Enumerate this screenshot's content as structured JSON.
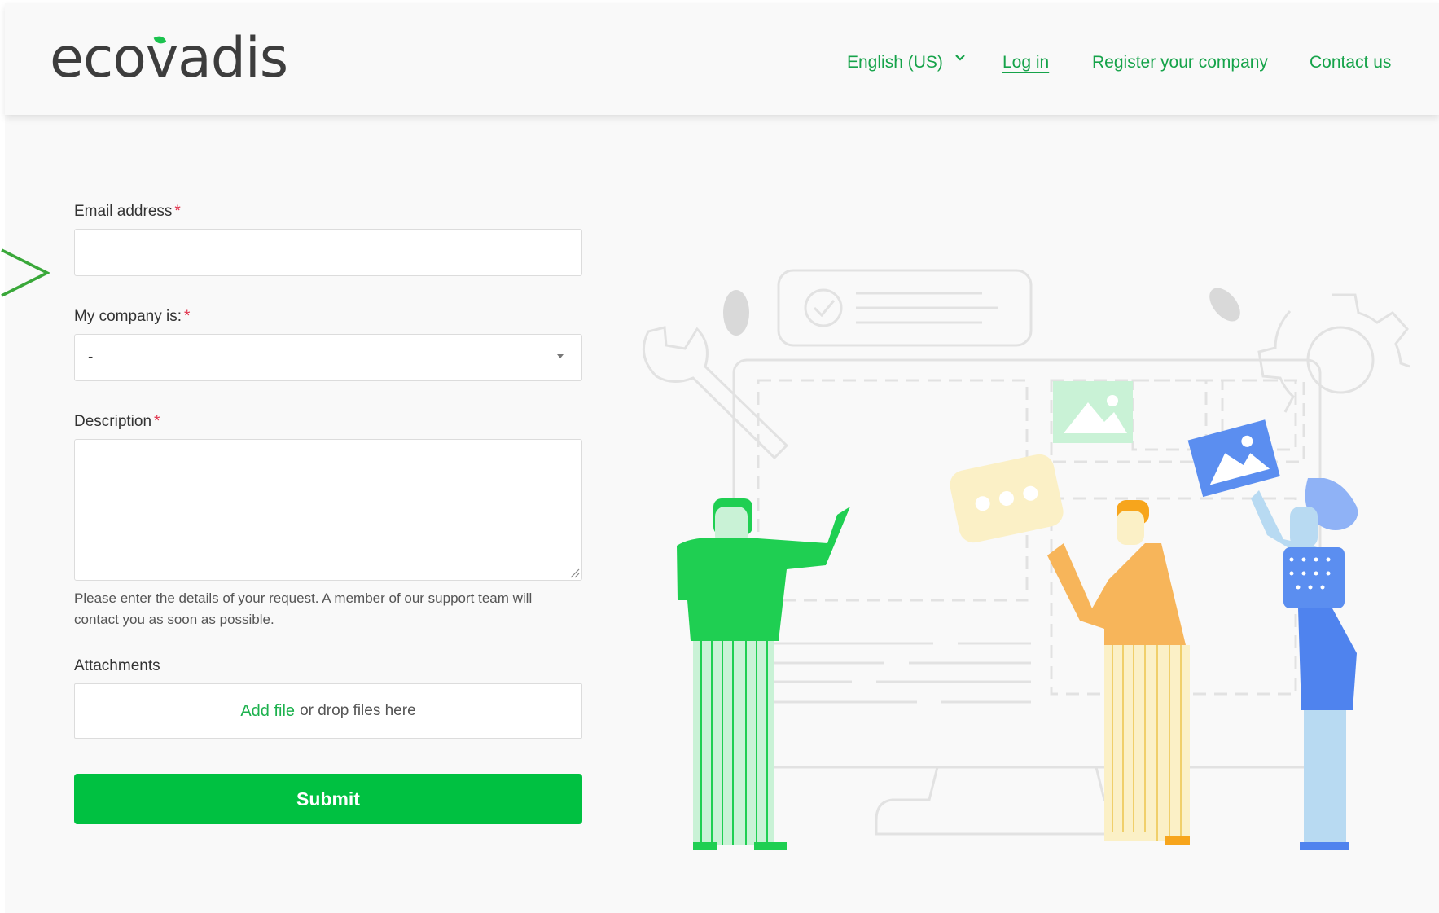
{
  "brand": {
    "logo_text": "ecovadis",
    "accent": "#1cc34f"
  },
  "nav": {
    "language": "English (US)",
    "login": "Log in",
    "register": "Register your company",
    "contact": "Contact us"
  },
  "form": {
    "email_label": "Email address",
    "company_label": "My company is:",
    "company_value": "-",
    "description_label": "Description",
    "description_help": "Please enter the details of your request. A member of our support team will contact you as soon as possible.",
    "attachments_label": "Attachments",
    "add_file": "Add file",
    "drop_text": "or drop files here",
    "submit": "Submit",
    "required_mark": "*"
  },
  "icons": {
    "chevron": "chevron-down-icon",
    "pointer": "arrow-pointer-icon",
    "resize": "resize-grip-icon"
  },
  "colors": {
    "nav_link": "#16a34a",
    "submit_bg": "#00c141",
    "required": "#e0324b"
  }
}
